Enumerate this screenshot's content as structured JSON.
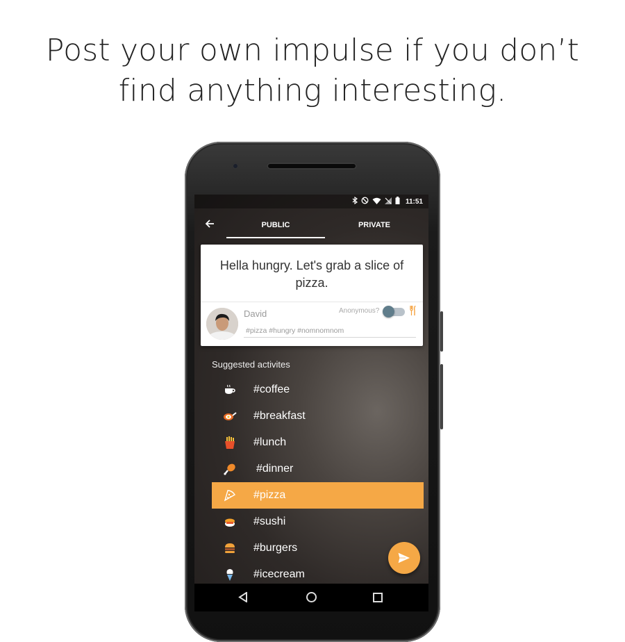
{
  "headline": {
    "line1": "Post your own impulse if you don’t",
    "line2": "find anything interesting."
  },
  "status_bar": {
    "time": "11:51",
    "icons": [
      "bluetooth-icon",
      "do-not-disturb-icon",
      "wifi-icon",
      "no-signal-icon",
      "battery-icon"
    ]
  },
  "tabs": [
    {
      "label": "PUBLIC",
      "selected": true
    },
    {
      "label": "PRIVATE",
      "selected": false
    }
  ],
  "post": {
    "text": "Hella hungry. Let's grab a slice of pizza.",
    "author": "David",
    "anonymous_label": "Anonymous?",
    "anonymous": false,
    "tags": "#pizza #hungry #nomnomnom"
  },
  "suggestions": {
    "title": "Suggested activites",
    "items": [
      {
        "label": "#coffee",
        "icon": "coffee-icon",
        "selected": false
      },
      {
        "label": "#breakfast",
        "icon": "frying-pan-icon",
        "selected": false
      },
      {
        "label": "#lunch",
        "icon": "fries-icon",
        "selected": false
      },
      {
        "label": "#dinner",
        "icon": "drumstick-icon",
        "selected": false
      },
      {
        "label": "#pizza",
        "icon": "pizza-icon",
        "selected": true
      },
      {
        "label": "#sushi",
        "icon": "sushi-icon",
        "selected": false
      },
      {
        "label": "#burgers",
        "icon": "burger-icon",
        "selected": false
      },
      {
        "label": "#icecream",
        "icon": "ice-cream-icon",
        "selected": false
      }
    ]
  },
  "colors": {
    "accent": "#f5a846",
    "toggle_knob": "#607d8b"
  }
}
